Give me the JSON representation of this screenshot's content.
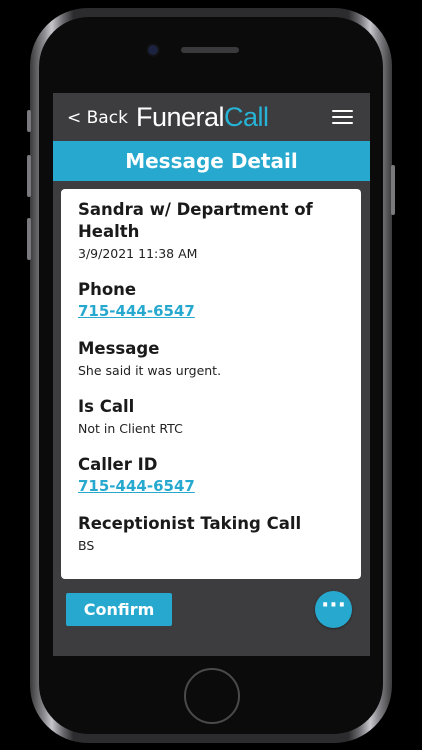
{
  "nav": {
    "back_label": "< Back",
    "logo_main": "Funeral",
    "logo_accent": "Call",
    "menu_icon": "hamburger-menu-icon"
  },
  "title": "Message Detail",
  "message": {
    "caller": "Sandra w/ Department of Health",
    "datetime": "3/9/2021 11:38 AM",
    "phone_label": "Phone",
    "phone_value": "715-444-6547",
    "message_label": "Message",
    "message_value": "She said it was urgent.",
    "is_call_label": "Is Call",
    "is_call_value": "Not in Client RTC",
    "caller_id_label": "Caller ID",
    "caller_id_value": "715-444-6547",
    "receptionist_label": "Receptionist Taking Call",
    "receptionist_value": "BS"
  },
  "actions": {
    "confirm_label": "Confirm",
    "more_icon": "more-options-icon",
    "more_label": "···"
  },
  "colors": {
    "accent": "#27a9cf",
    "header_bg": "#3d3d3f",
    "card_bg": "#ffffff"
  }
}
